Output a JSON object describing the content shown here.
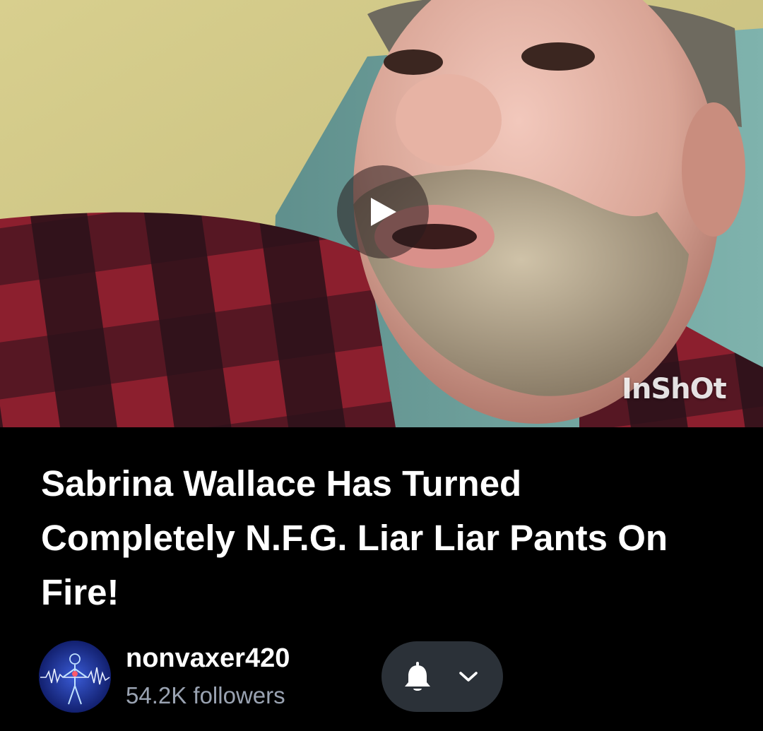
{
  "video": {
    "watermark": "InShOt",
    "play_icon": "play-icon"
  },
  "post": {
    "title": "Sabrina Wallace Has Turned Completely N.F.G. Liar Liar Pants On Fire!"
  },
  "channel": {
    "name": "nonvaxer420",
    "followers": "54.2K followers",
    "avatar_icon": "body-scan-avatar-icon"
  },
  "actions": {
    "notify_icon": "bell-icon",
    "menu_icon": "chevron-down-icon"
  },
  "colors": {
    "background": "#000000",
    "pill": "#2b3138",
    "followers_text": "#9aa3b2"
  }
}
